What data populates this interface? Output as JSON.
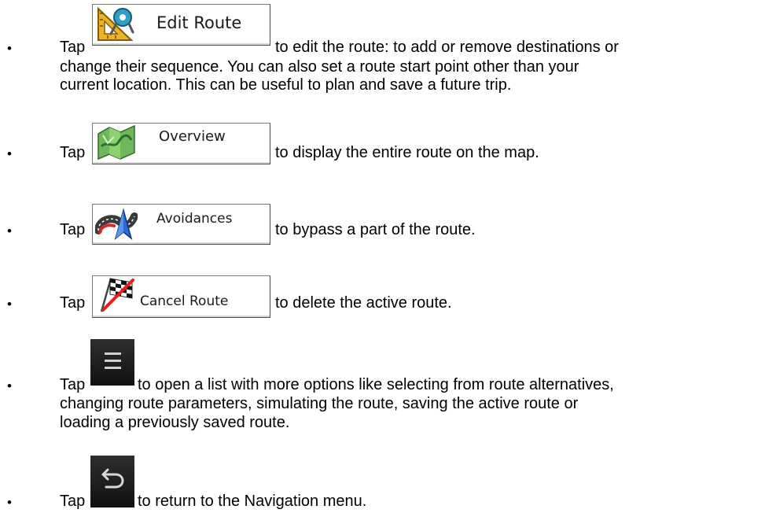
{
  "items": [
    {
      "tap": "Tap",
      "button_label": "Edit Route",
      "icon": "set-square-compass-icon",
      "lines": [
        "to edit the route: to add or remove destinations or",
        "change their sequence. You can also set a route start point other than your",
        "current location. This can be useful to plan and save a future trip."
      ]
    },
    {
      "tap": "Tap",
      "button_label": "Overview",
      "icon": "map-overview-icon",
      "lines": [
        "to display the entire route on the map."
      ]
    },
    {
      "tap": "Tap",
      "button_label": "Avoidances",
      "icon": "road-avoid-icon",
      "lines": [
        "to bypass a part of the route."
      ]
    },
    {
      "tap": "Tap",
      "button_label": "Cancel Route",
      "icon": "checkered-flag-crossed-icon",
      "lines": [
        "to delete the active route."
      ]
    },
    {
      "tap": "Tap",
      "icon": "hamburger-menu-icon",
      "lines": [
        "to open a list with more options like selecting from route alternatives,",
        "changing route parameters, simulating the route, saving the active route or",
        "loading a previously saved route."
      ]
    },
    {
      "tap": "Tap",
      "icon": "back-arrow-icon",
      "lines": [
        "to return to the Navigation menu."
      ]
    }
  ]
}
